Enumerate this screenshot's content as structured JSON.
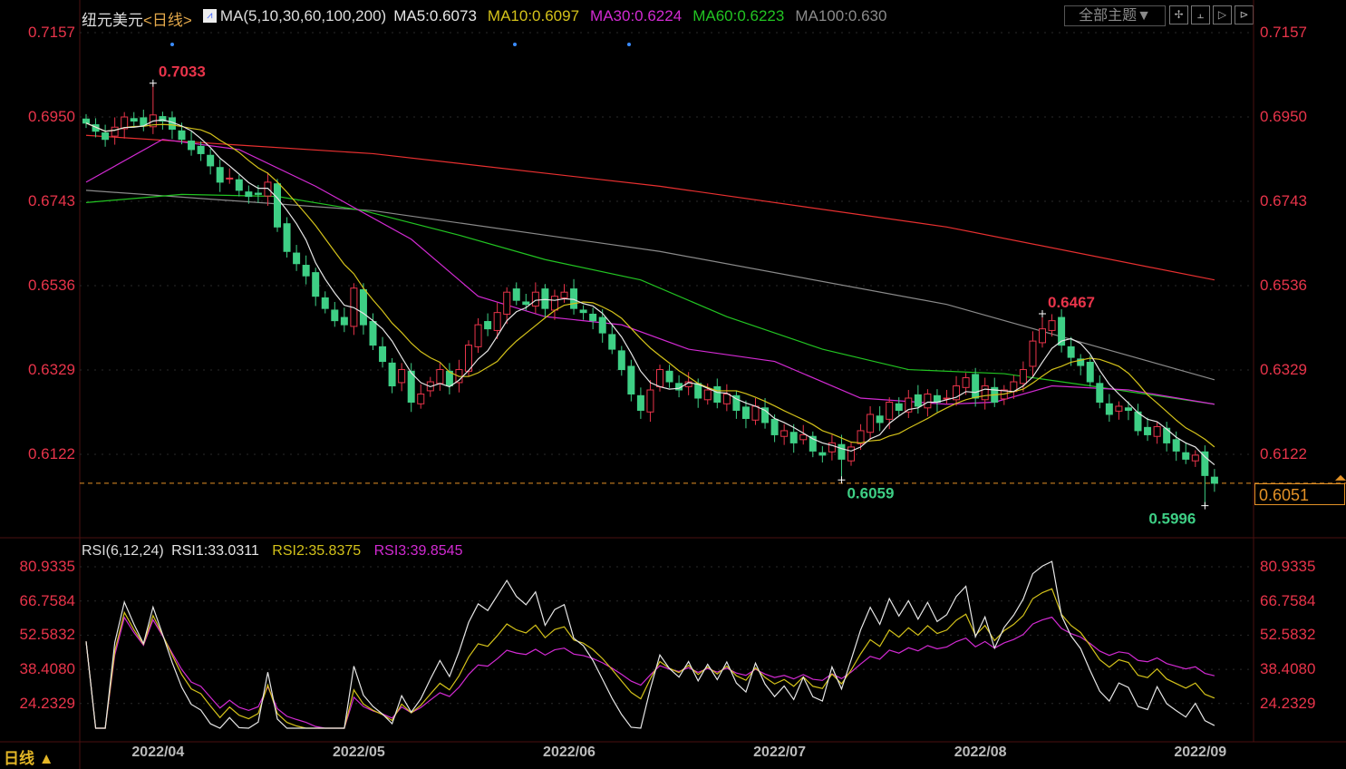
{
  "header": {
    "symbol": "纽元美元",
    "period": "<日线>",
    "ma_label": "MA(5,10,30,60,100,200)",
    "ma5": "MA5:0.6073",
    "ma10": "MA10:0.6097",
    "ma30": "MA30:0.6224",
    "ma60": "MA60:0.6223",
    "ma100": "MA100:0.630"
  },
  "toolbar": {
    "theme_label": "全部主题▼",
    "tools": [
      "✢",
      "⫠",
      "▷",
      "⊳"
    ]
  },
  "rsi_header": {
    "label": "RSI(6,12,24)",
    "rsi1": "RSI1:33.0311",
    "rsi2": "RSI2:35.8375",
    "rsi3": "RSI3:39.8545"
  },
  "footer": {
    "period_label": "日线 ▲"
  },
  "colors": {
    "up": "#e8344a",
    "down": "#3ecf85",
    "ma5": "#e6e6e6",
    "ma10": "#d4c21a",
    "ma30": "#d22ad2",
    "ma60": "#22c422",
    "ma100": "#8a8a8a",
    "ma200": "#e83030",
    "rsi1": "#e6e6e6",
    "rsi2": "#d4c21a",
    "rsi3": "#d22ad2",
    "current": "#e39126"
  },
  "current_price": "0.6051",
  "chart_data": {
    "type": "candlestick",
    "title": "纽元美元 日线",
    "price_ticks": [
      "0.7157",
      "0.6950",
      "0.6743",
      "0.6536",
      "0.6329",
      "0.6122"
    ],
    "ylim": [
      0.594,
      0.719
    ],
    "rsi_ticks": [
      "80.9335",
      "66.7584",
      "52.5832",
      "38.4080",
      "24.2329"
    ],
    "rsi_ylim": [
      14,
      87
    ],
    "x_labels": [
      {
        "label": "2022/04",
        "index": 8
      },
      {
        "label": "2022/05",
        "index": 29
      },
      {
        "label": "2022/06",
        "index": 51
      },
      {
        "label": "2022/07",
        "index": 73
      },
      {
        "label": "2022/08",
        "index": 94
      },
      {
        "label": "2022/09",
        "index": 117
      }
    ],
    "closes": [
      0.6935,
      0.6915,
      0.6895,
      0.6925,
      0.695,
      0.694,
      0.693,
      0.6955,
      0.694,
      0.692,
      0.6895,
      0.687,
      0.686,
      0.683,
      0.679,
      0.68,
      0.677,
      0.6755,
      0.676,
      0.679,
      0.668,
      0.662,
      0.659,
      0.656,
      0.651,
      0.648,
      0.645,
      0.644,
      0.653,
      0.644,
      0.639,
      0.635,
      0.629,
      0.633,
      0.625,
      0.627,
      0.63,
      0.633,
      0.629,
      0.633,
      0.639,
      0.644,
      0.643,
      0.647,
      0.652,
      0.65,
      0.649,
      0.652,
      0.648,
      0.651,
      0.652,
      0.648,
      0.647,
      0.645,
      0.642,
      0.638,
      0.633,
      0.627,
      0.623,
      0.628,
      0.633,
      0.63,
      0.628,
      0.63,
      0.626,
      0.628,
      0.625,
      0.627,
      0.623,
      0.621,
      0.624,
      0.62,
      0.617,
      0.618,
      0.615,
      0.617,
      0.613,
      0.612,
      0.615,
      0.611,
      0.614,
      0.618,
      0.622,
      0.62,
      0.625,
      0.623,
      0.626,
      0.624,
      0.627,
      0.625,
      0.626,
      0.629,
      0.631,
      0.626,
      0.629,
      0.625,
      0.628,
      0.63,
      0.633,
      0.64,
      0.643,
      0.645,
      0.639,
      0.636,
      0.634,
      0.63,
      0.625,
      0.622,
      0.624,
      0.623,
      0.618,
      0.617,
      0.619,
      0.615,
      0.613,
      0.611,
      0.612,
      0.607,
      0.6051
    ],
    "extremes": [
      {
        "index": 7,
        "type": "high",
        "value": 0.7033,
        "label": "0.7033"
      },
      {
        "index": 100,
        "type": "high",
        "value": 0.6467,
        "label": "0.6467"
      },
      {
        "index": 79,
        "type": "low",
        "value": 0.6059,
        "label": "0.6059"
      },
      {
        "index": 117,
        "type": "low",
        "value": 0.5996,
        "label": "0.5996"
      }
    ],
    "long_mas": {
      "ma30": [
        [
          0,
          0.679
        ],
        [
          8,
          0.6895
        ],
        [
          16,
          0.687
        ],
        [
          24,
          0.678
        ],
        [
          34,
          0.665
        ],
        [
          41,
          0.651
        ],
        [
          48,
          0.646
        ],
        [
          56,
          0.644
        ],
        [
          63,
          0.638
        ],
        [
          72,
          0.635
        ],
        [
          81,
          0.626
        ],
        [
          90,
          0.6245
        ],
        [
          95,
          0.625
        ],
        [
          101,
          0.629
        ],
        [
          109,
          0.628
        ],
        [
          118,
          0.6245
        ]
      ],
      "ma60": [
        [
          0,
          0.674
        ],
        [
          10,
          0.676
        ],
        [
          20,
          0.6755
        ],
        [
          29,
          0.672
        ],
        [
          39,
          0.666
        ],
        [
          48,
          0.66
        ],
        [
          58,
          0.655
        ],
        [
          67,
          0.646
        ],
        [
          77,
          0.638
        ],
        [
          86,
          0.633
        ],
        [
          96,
          0.632
        ],
        [
          105,
          0.629
        ],
        [
          118,
          0.6245
        ]
      ],
      "ma100": [
        [
          0,
          0.677
        ],
        [
          30,
          0.672
        ],
        [
          60,
          0.662
        ],
        [
          90,
          0.649
        ],
        [
          118,
          0.6305
        ]
      ],
      "ma200": [
        [
          0,
          0.6905
        ],
        [
          30,
          0.686
        ],
        [
          60,
          0.678
        ],
        [
          90,
          0.668
        ],
        [
          118,
          0.655
        ]
      ]
    }
  }
}
